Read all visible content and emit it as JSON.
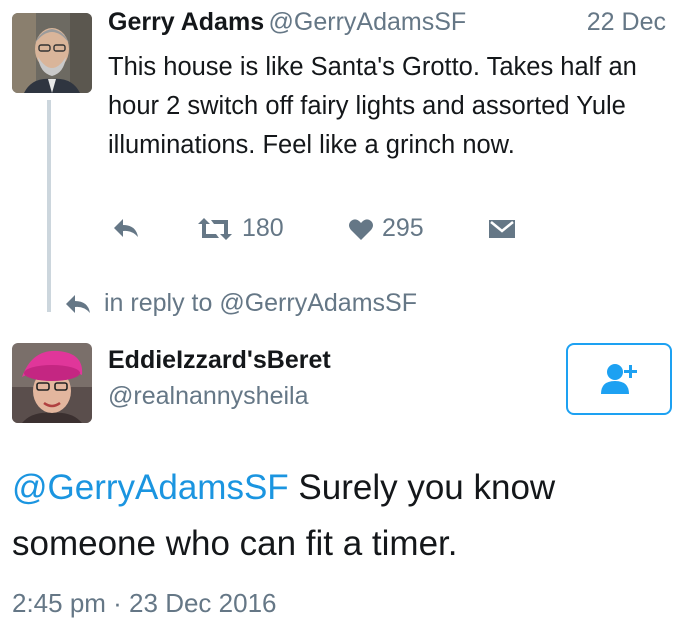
{
  "original_tweet": {
    "author_name": "Gerry Adams",
    "author_handle": "@GerryAdamsSF",
    "date": "22 Dec",
    "text": "This house is like Santa's Grotto. Takes half an hour 2 switch off fairy lights and assorted Yule illuminations. Feel like a grinch now.",
    "retweet_count": "180",
    "like_count": "295"
  },
  "reply_context": {
    "text": "in reply to @GerryAdamsSF"
  },
  "reply": {
    "author_name": "EddieIzzard'sBeret",
    "author_handle": "@realnannysheila",
    "mention": "@GerryAdamsSF",
    "text": " Surely you know someone who can fit a timer.",
    "timestamp": "2:45 pm · 23 Dec 2016"
  },
  "colors": {
    "accent": "#1da1f2",
    "link": "#1b95e0",
    "secondary_text": "#657786",
    "thread_line": "#ccd6dd"
  },
  "icons": {
    "reply": "reply-arrow-icon",
    "retweet": "retweet-icon",
    "like": "heart-icon",
    "dm": "envelope-icon",
    "follow": "add-user-icon"
  }
}
